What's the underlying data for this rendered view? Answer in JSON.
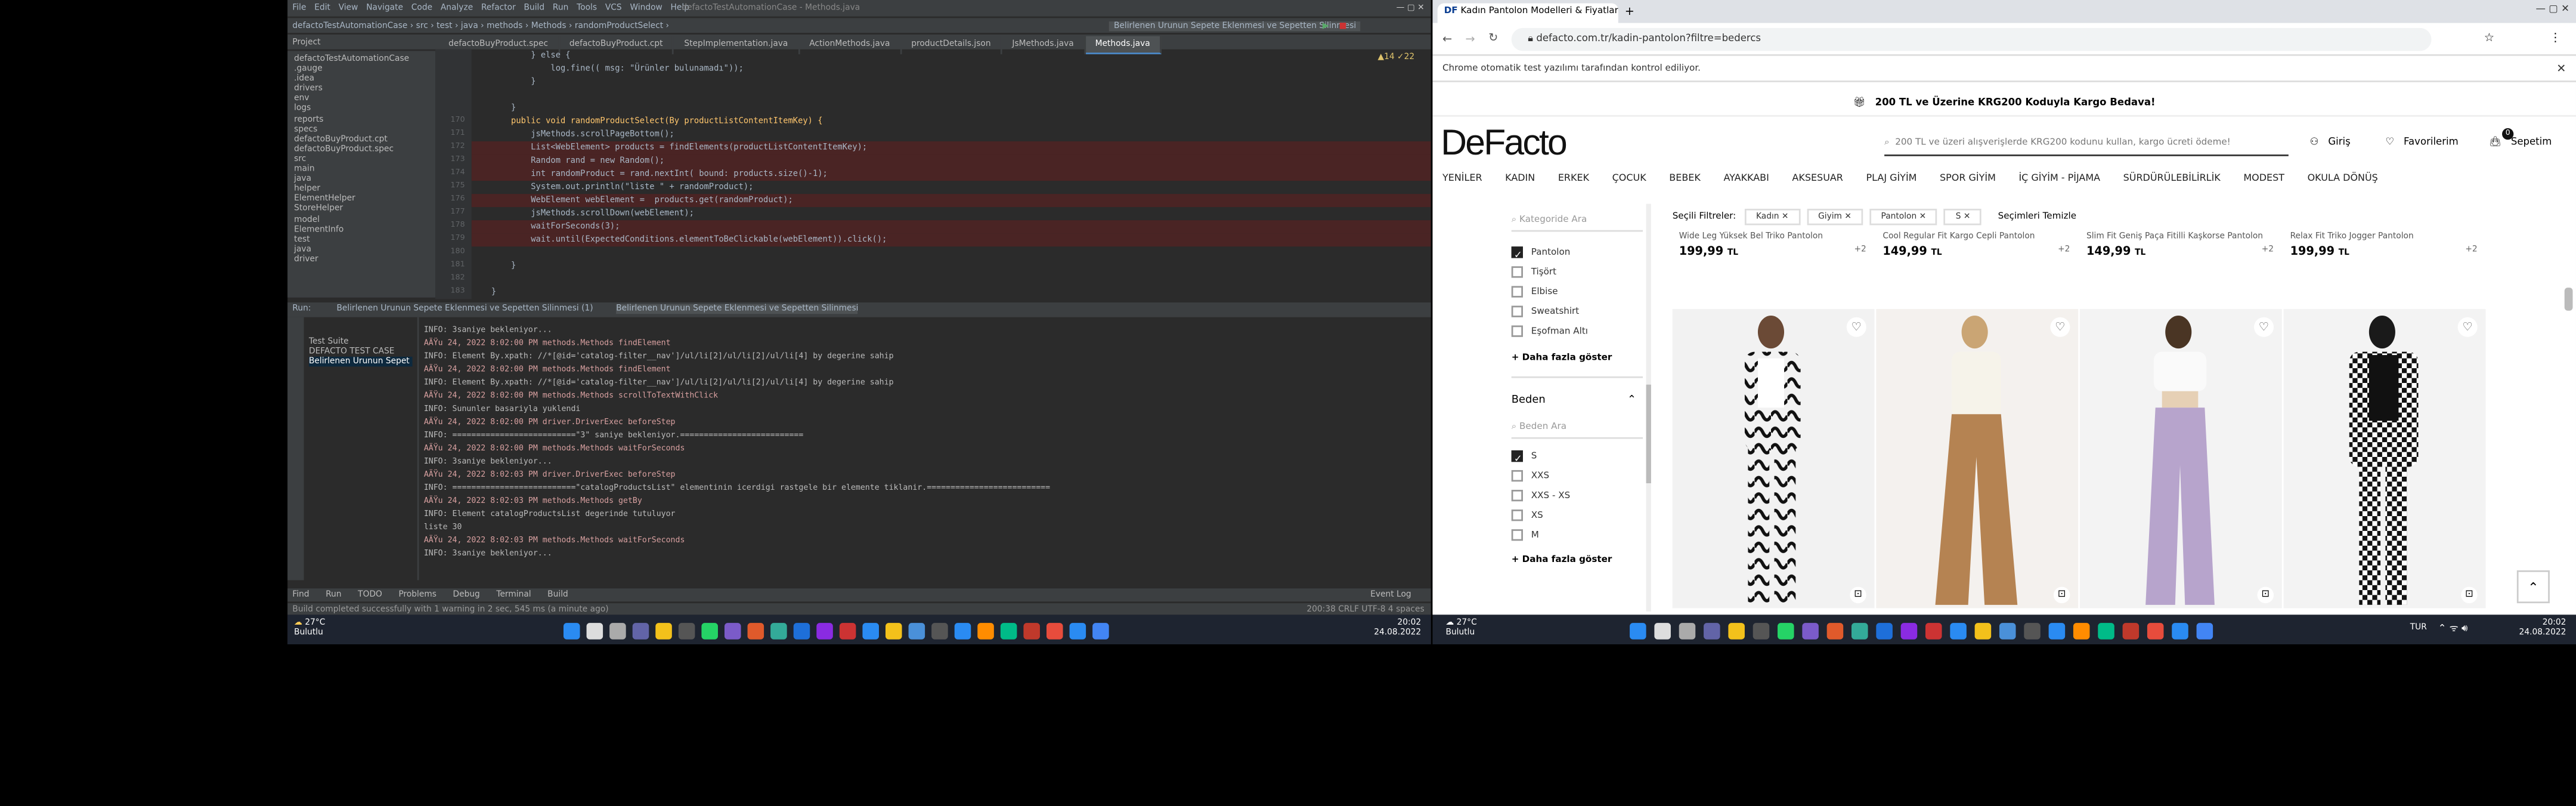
{
  "ide": {
    "title": "defactoTestAutomationCase - Methods.java",
    "menu": [
      "File",
      "Edit",
      "View",
      "Navigate",
      "Code",
      "Analyze",
      "Refactor",
      "Build",
      "Run",
      "Tools",
      "VCS",
      "Window",
      "Help"
    ],
    "breadcrumb": [
      "defactoTestAutomationCase",
      "src",
      "test",
      "java",
      "methods",
      "Methods",
      "randomProductSelect"
    ],
    "run_config": "Belirlenen Urunun Sepete Eklenmesi ve Sepetten Silinmesi",
    "tabs": [
      "defactoBuyProduct.spec",
      "defactoBuyProduct.cpt",
      "StepImplementation.java",
      "ActionMethods.java",
      "productDetails.json",
      "JsMethods.java",
      "Methods.java"
    ],
    "project_label": "Project",
    "tree": [
      "defactoTestAutomationCase",
      "  .gauge",
      "  .idea",
      "  drivers",
      "  env",
      "  logs",
      "  reports",
      "  specs",
      "    defactoBuyProduct.cpt",
      "    defactoBuyProduct.spec",
      "  src",
      "    main",
      "      java",
      "        helper",
      "          ElementHelper",
      "          StoreHelper",
      "        model",
      "          ElementInfo",
      "    test",
      "      java",
      "        driver"
    ],
    "line_numbers": [
      "",
      "",
      "",
      "",
      "",
      "170",
      "171",
      "172",
      "173",
      "174",
      "175",
      "176",
      "177",
      "178",
      "179",
      "180",
      "181",
      "182",
      "183"
    ],
    "code": [
      "            } else {",
      "                log.fine(( msg: \"Ürünler bulunamadı\"));",
      "            }",
      "",
      "        }",
      "        public void randomProductSelect(By productListContentItemKey) {",
      "            jsMethods.scrollPageBottom();",
      "            List<WebElement> products = findElements(productListContentItemKey);",
      "            Random rand = new Random();",
      "            int randomProduct = rand.nextInt( bound: products.size()-1);",
      "            System.out.println(\"liste \" + randomProduct);",
      "            WebElement webElement =  products.get(randomProduct);",
      "            jsMethods.scrollDown(webElement);",
      "            waitForSeconds(3);",
      "            wait.until(ExpectedConditions.elementToBeClickable(webElement)).click();",
      "",
      "        }",
      "",
      "    }"
    ],
    "inspection": "▲14  ✓22",
    "run_panel": {
      "run_label": "Run:",
      "run_tabs": [
        "Belirlenen Urunun Sepete Eklenmesi ve Sepetten Silinmesi (1)",
        "Belirlenen Urunun Sepete Eklenmesi ve Sepetten Silinmesi"
      ],
      "test_tree": [
        "Test Suite",
        "DEFACTO TEST CASE",
        "Belirlenen Urunun Sepet"
      ],
      "console": [
        "INFO: 3saniye bekleniyor...",
        "AÄŸu 24, 2022 8:02:00 PM methods.Methods findElement",
        "INFO: Element By.xpath: //*[@id='catalog-filter__nav']/ul/li[2]/ul/li[2]/ul/li[4] by degerine sahip",
        "AÄŸu 24, 2022 8:02:00 PM methods.Methods findElement",
        "INFO: Element By.xpath: //*[@id='catalog-filter__nav']/ul/li[2]/ul/li[2]/ul/li[4] by degerine sahip",
        "AÄŸu 24, 2022 8:02:00 PM methods.Methods scrollToTextWithClick",
        "INFO: Sununler basariyla yuklendi",
        "AÄŸu 24, 2022 8:02:00 PM driver.DriverExec beforeStep",
        "INFO: ==========================\"3\" saniye bekleniyor.==========================",
        "AÄŸu 24, 2022 8:02:00 PM methods.Methods waitForSeconds",
        "INFO: 3saniye bekleniyor...",
        "AÄŸu 24, 2022 8:02:03 PM driver.DriverExec beforeStep",
        "INFO: ==========================\"catalogProductsList\" elementinin icerdigi rastgele bir elemente tiklanir.==========================",
        "AÄŸu 24, 2022 8:02:03 PM methods.Methods getBy",
        "INFO: Element catalogProductsList degerinde tutuluyor",
        "liste 30",
        "AÄŸu 24, 2022 8:02:03 PM methods.Methods waitForSeconds",
        "INFO: 3saniye bekleniyor..."
      ]
    },
    "bottom_tabs": [
      "Find",
      "Run",
      "TODO",
      "Problems",
      "Debug",
      "Terminal",
      "Build"
    ],
    "event_log": "Event Log",
    "status": "Build completed successfully with 1 warning in 2 sec, 545 ms (a minute ago)",
    "status_right": "200:38   CRLF   UTF-8   4 spaces"
  },
  "taskbar_left": {
    "temp": "27°C",
    "cond": "Bulutlu",
    "time": "20:02",
    "date": "24.08.2022"
  },
  "browser": {
    "tab_title": "Kadın Pantolon Modelleri & Fiyatları",
    "url": "defacto.com.tr/kadin-pantolon?filtre=bedercs",
    "automation_notice": "Chrome otomatik test yazılımı tarafından kontrol ediliyor.",
    "promo": "200 TL ve Üzerine KRG200 Koduyla Kargo Bedava!",
    "logo": "DeFacto",
    "search_placeholder": "200 TL ve üzeri alışverişlerde KRG200 kodunu kullan, kargo ücreti ödeme!",
    "login": "Giriş",
    "favorites": "Favorilerim",
    "cart": "Sepetim",
    "cart_count": "0",
    "nav": [
      "YENİLER",
      "KADIN",
      "ERKEK",
      "ÇOCUK",
      "BEBEK",
      "AYAKKABI",
      "AKSESUAR",
      "PLAJ GİYİM",
      "SPOR GİYİM",
      "İÇ GİYİM - PİJAMA",
      "SÜRDÜRÜLEBİLİRLİK",
      "MODEST",
      "OKULA DÖNÜŞ"
    ],
    "category_search": "Kategoride Ara",
    "categories": [
      {
        "label": "Pantolon",
        "checked": true
      },
      {
        "label": "Tişört",
        "checked": false
      },
      {
        "label": "Elbise",
        "checked": false
      },
      {
        "label": "Sweatshirt",
        "checked": false
      },
      {
        "label": "Eşofman Altı",
        "checked": false
      }
    ],
    "more1": "+ Daha fazla göster",
    "size_title": "Beden",
    "size_search": "Beden Ara",
    "sizes": [
      {
        "label": "S",
        "checked": true
      },
      {
        "label": "XXS",
        "checked": false
      },
      {
        "label": "XXS - XS",
        "checked": false
      },
      {
        "label": "XS",
        "checked": false
      },
      {
        "label": "M",
        "checked": false
      }
    ],
    "more2": "+ Daha fazla göster",
    "selected_filters_label": "Seçili Filtreler:",
    "chips": [
      "Kadın",
      "Giyim",
      "Pantolon",
      "S"
    ],
    "clear": "Seçimleri Temizle",
    "top_products": [
      {
        "name": "Wide Leg Yüksek Bel Triko Pantolon",
        "price": "199,99",
        "cur": "TL",
        "more": "+2"
      },
      {
        "name": "Cool Regular Fit Kargo Cepli Pantolon",
        "price": "149,99",
        "cur": "TL",
        "more": "+2"
      },
      {
        "name": "Slim Fit Geniş Paça Fitilli Kaşkorse Pantolon",
        "price": "149,99",
        "cur": "TL",
        "more": "+2"
      },
      {
        "name": "Relax Fit Triko Jogger Pantolon",
        "price": "199,99",
        "cur": "TL",
        "more": "+2"
      }
    ]
  },
  "taskbar_right": {
    "temp": "27°C",
    "cond": "Bulutlu",
    "lang": "TUR",
    "time": "20:02",
    "date": "24.08.2022"
  },
  "colors": {
    "ide_bg": "#2b2b2b",
    "ide_panel": "#3c3f41",
    "browser_bg": "#ffffff",
    "taskbar": "#1e2430",
    "accent": "#4a88c7"
  }
}
